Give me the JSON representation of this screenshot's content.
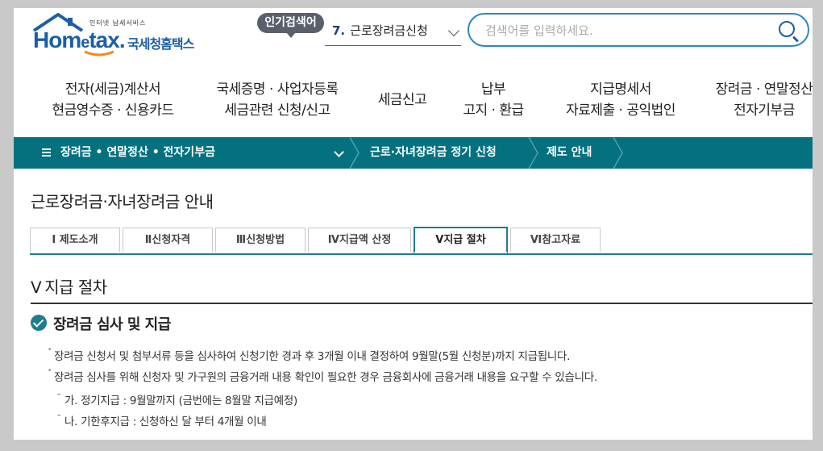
{
  "header": {
    "logo_tagline": "인터넷 납세서비스",
    "logo_home": "Hom",
    "logo_e": "e",
    "logo_tax": "tax.",
    "logo_korean": "국세청홈택스",
    "popular_badge": "인기검색어",
    "popular_rank": "7.",
    "popular_keyword": "근로장려금신청",
    "search_placeholder": "검색어를 입력하세요."
  },
  "gnb": [
    {
      "line1": "전자(세금)계산서",
      "line2": "현금영수증 · 신용카드"
    },
    {
      "line1": "국세증명 · 사업자등록",
      "line2": "세금관련 신청/신고"
    },
    {
      "line1": "세금신고",
      "line2": ""
    },
    {
      "line1": "납부",
      "line2": "고지 · 환급"
    },
    {
      "line1": "지급명세서",
      "line2": "자료제출 · 공익법인"
    },
    {
      "line1": "장려금 · 연말정산",
      "line2": "전자기부금"
    }
  ],
  "location": {
    "menu": "장려금 • 연말정산 • 전자기부금",
    "crumbs": [
      "근로·자녀장려금 정기 신청",
      "제도 안내"
    ]
  },
  "page_title": "근로장려금·자녀장려금 안내",
  "tabs": [
    {
      "label": "Ⅰ 제도소개",
      "active": false
    },
    {
      "label": "Ⅱ신청자격",
      "active": false
    },
    {
      "label": "Ⅲ신청방법",
      "active": false
    },
    {
      "label": "Ⅳ지급액 산정",
      "active": false
    },
    {
      "label": "Ⅴ지급 절차",
      "active": true
    },
    {
      "label": "Ⅵ참고자료",
      "active": false
    }
  ],
  "section": {
    "lead": "Ⅴ",
    "title": "지급 절차"
  },
  "subsection": "장려금 심사 및 지급",
  "bullets": [
    "장려금 신청서 및 첨부서류 등을 심사하여 신청기한 경과 후 3개월 이내 결정하여 9월말(5월 신청분)까지 지급됩니다.",
    "장려금 심사를 위해 신청자 및 가구원의 금융거래 내용 확인이 필요한 경우 금융회사에 금융거래 내용을 요구할 수 있습니다."
  ],
  "sub_bullets": [
    "가. 정기지급 : 9월말까지 (금번에는 8월말 지급예정)",
    "나. 기한후지급 : 신청하신 달 부터 4개월 이내"
  ],
  "colors": {
    "brand_blue": "#1a5fa8",
    "teal": "#05717e",
    "accent_orange": "#f08a1c"
  }
}
